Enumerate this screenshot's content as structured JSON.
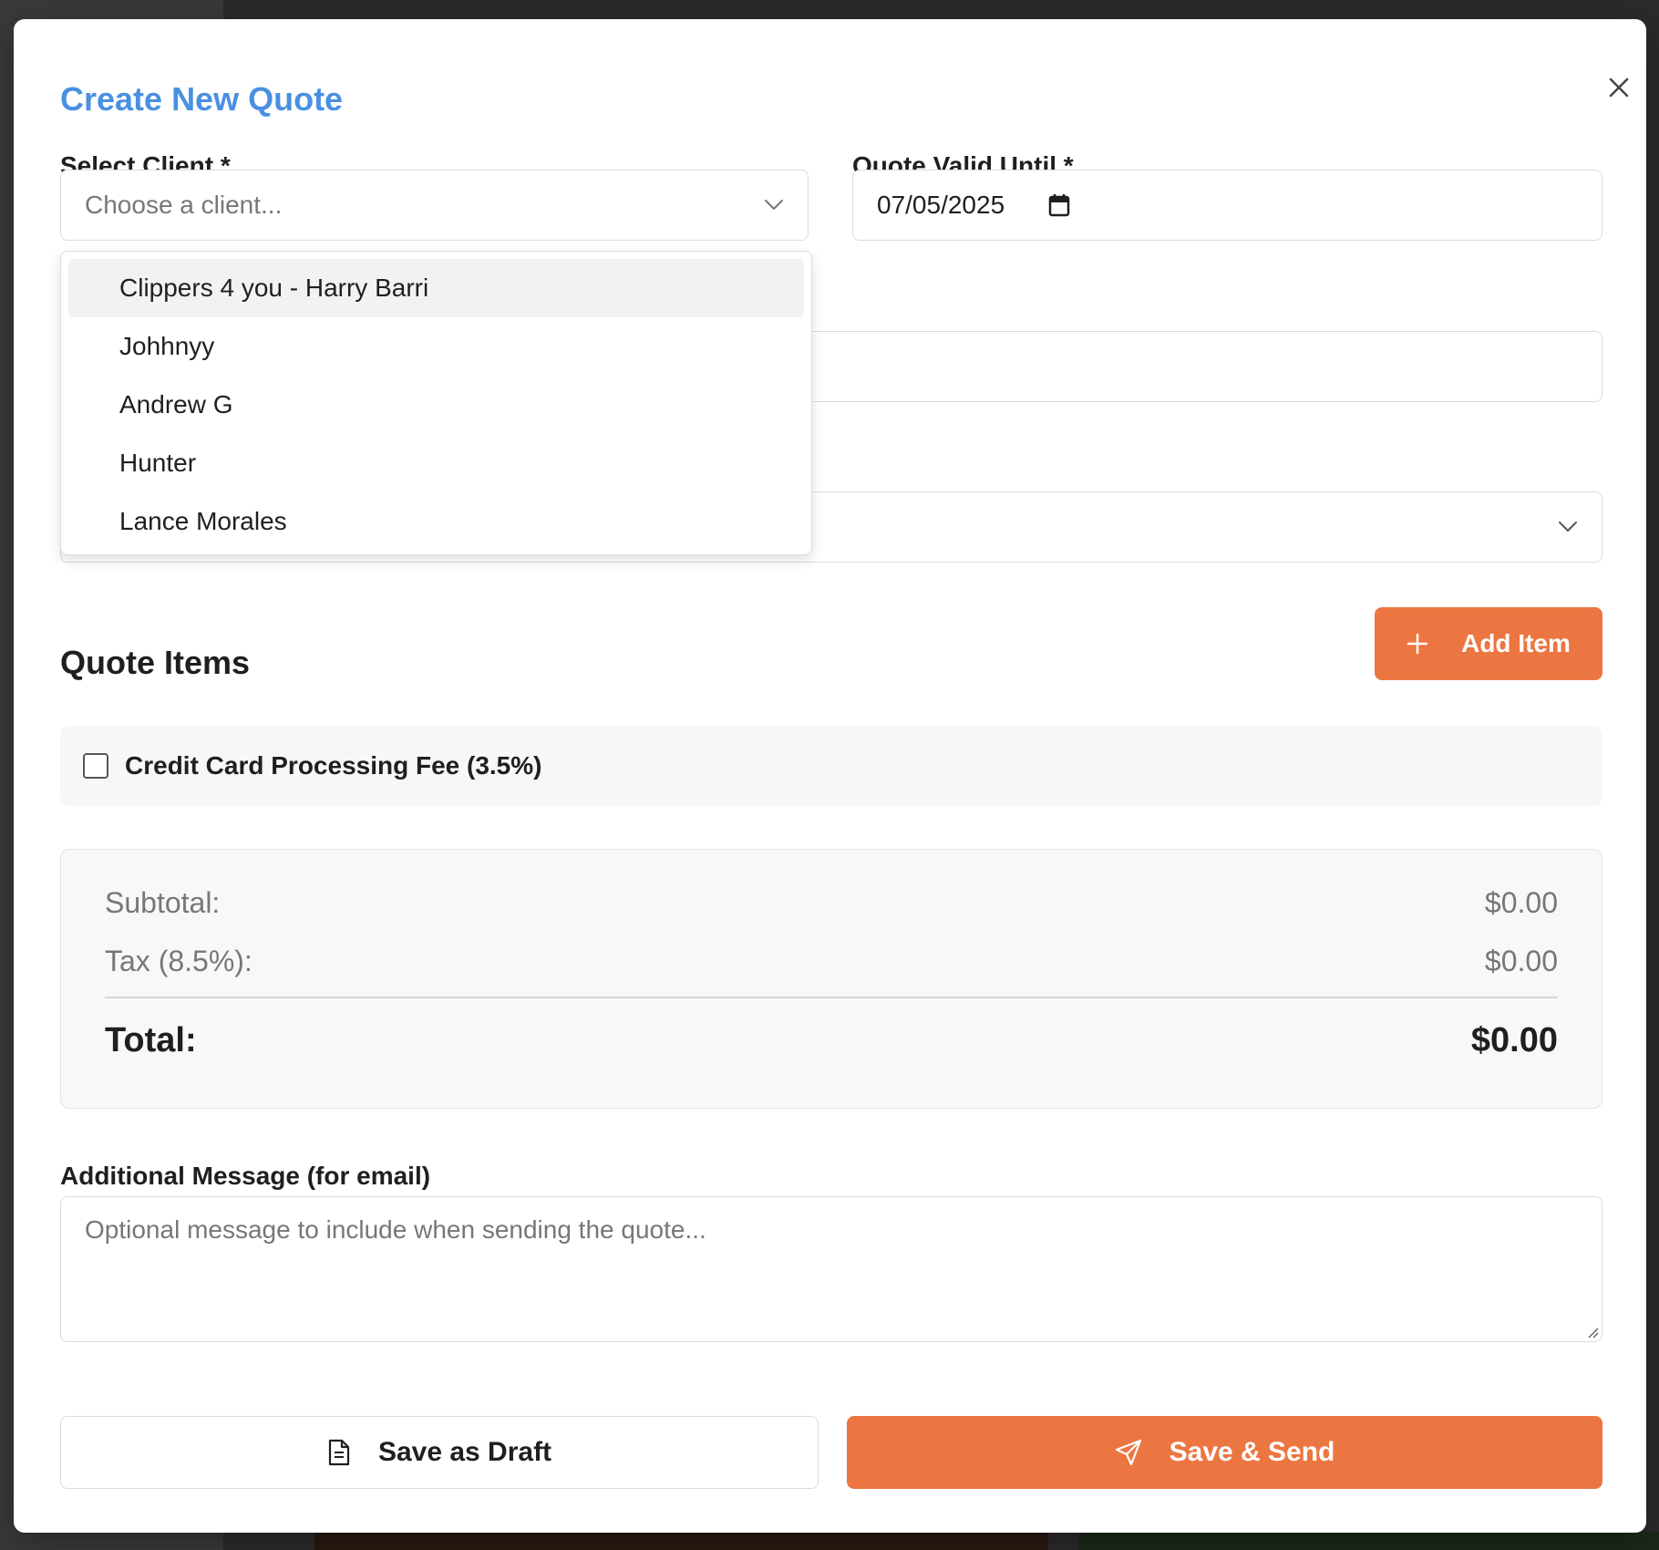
{
  "modal": {
    "title": "Create New Quote"
  },
  "form": {
    "client_label": "Select Client *",
    "client_placeholder": "Choose a client...",
    "valid_until_label": "Quote Valid Until *",
    "valid_until_value": "07/05/2025"
  },
  "client_dropdown": {
    "options": [
      "Clippers 4 you - Harry Barri",
      "Johhnyy",
      "Andrew G",
      "Hunter",
      "Lance Morales"
    ],
    "highlighted_index": 0
  },
  "quote_items": {
    "title": "Quote Items",
    "add_item_label": "Add Item"
  },
  "fee": {
    "label": "Credit Card Processing Fee (3.5%)",
    "checked": false
  },
  "totals": {
    "subtotal_label": "Subtotal:",
    "subtotal_value": "$0.00",
    "tax_label": "Tax (8.5%):",
    "tax_value": "$0.00",
    "total_label": "Total:",
    "total_value": "$0.00"
  },
  "message": {
    "label": "Additional Message (for email)",
    "placeholder": "Optional message to include when sending the quote..."
  },
  "actions": {
    "draft_label": "Save as Draft",
    "send_label": "Save & Send"
  },
  "colors": {
    "title_blue": "#4a90e2",
    "accent_orange": "#ec7641"
  },
  "icons": [
    "close-icon",
    "chevron-down-icon",
    "calendar-icon",
    "plus-icon",
    "document-icon",
    "send-icon"
  ]
}
